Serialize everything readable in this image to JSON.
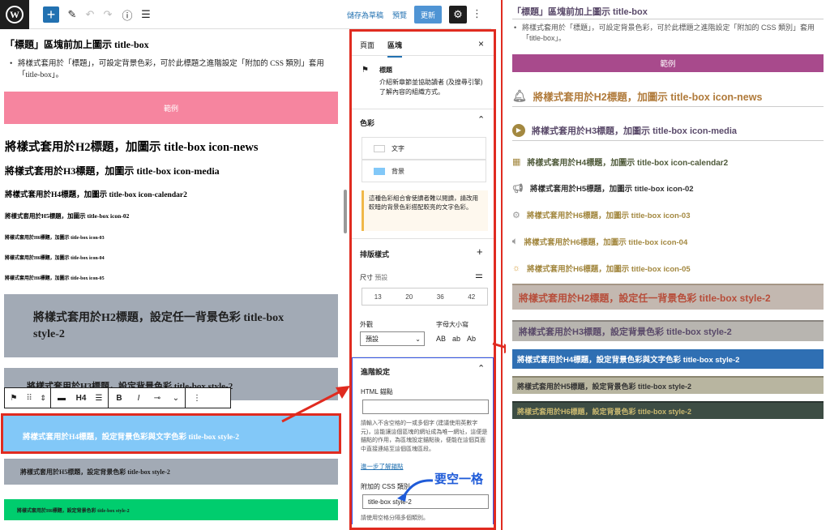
{
  "topbar": {
    "save_draft": "儲存為草稿",
    "preview": "預覽",
    "publish": "更新",
    "block_type": "H4"
  },
  "canvas": {
    "intro_heading": "「標題」區塊前加上圖示 title-box",
    "intro_bullet": "將樣式套用於「標題」，可設定背景色彩，可於此標題之進階設定「附加的 CSS 類別」套用「title-box」。",
    "example": "範例",
    "h2": "將樣式套用於H2標題，加圖示 title-box icon-news",
    "h3": "將樣式套用於H3標題，加圖示 title-box icon-media",
    "h4": "將樣式套用於H4標題，加圖示 title-box icon-calendar2",
    "h5": "將樣式套用於H5標題，加圖示 title-box icon-02",
    "h6a": "將樣式套用於H6標題，加圖示 title-box icon-03",
    "h6b": "將樣式套用於H6標題，加圖示 title-box icon-04",
    "h6c": "將樣式套用於H6標題，加圖示 title-box icon-05",
    "box_h2": "將樣式套用於H2標題，設定任一背景色彩 title-box style-2",
    "box_h3": "將樣式套用於H3標題，設定背景色彩 title-box style-2",
    "box_h4": "將樣式套用於H4標題，設定背景色彩與文字色彩 title-box style-2",
    "box_h5": "將樣式套用於H5標題，設定背景色彩 title-box style-2",
    "box_h6": "將樣式套用於H6標題，設定背景色彩 title-box style-2"
  },
  "sidebar": {
    "tab_page": "頁面",
    "tab_block": "區塊",
    "block_name": "標題",
    "block_desc": "介紹新章節並協助讀者 (及搜尋引擎) 了解內容的組織方式。",
    "color_title": "色彩",
    "color_text": "文字",
    "color_bg": "背景",
    "contrast_notice": "這種色彩組合會使讀者難以閱讀，請改用較暗的背景色彩搭配較亮的文字色彩。",
    "typo_title": "排版樣式",
    "size_label": "尺寸",
    "size_default": "預設",
    "sizes": [
      "13",
      "20",
      "36",
      "42"
    ],
    "appearance_label": "外觀",
    "appearance_value": "預設",
    "case_label": "字母大小寫",
    "case_options": [
      "AB",
      "ab",
      "Ab"
    ],
    "advanced_title": "進階設定",
    "anchor_label": "HTML 錨點",
    "anchor_help": "請輸入不含空格的一或多個字 (建議使用英數字元)，這能讓這個區塊的網址成為唯一網址，這便是錨點的作用，為區塊設定錨點後，便能在這個頁面中直接連結至這個區塊區段。",
    "anchor_link": "進一步了解錨點",
    "css_label": "附加的 CSS 類別",
    "css_value": "title-box style-2",
    "css_help": "請使用空格分隔多個類別。"
  },
  "annotation": {
    "text": "要空一格"
  },
  "right": {
    "heading": "「標題」區塊前加上圖示 title-box",
    "bullet": "將樣式套用於「標題」，可設定背景色彩，可於此標題之進階設定「附加的 CSS 類別」套用「title-box」。",
    "example": "範例",
    "h2": "將樣式套用於H2標題，加圖示 title-box icon-news",
    "h3": "將樣式套用於H3標題，加圖示 title-box icon-media",
    "h4": "將樣式套用於H4標題，加圖示 title-box icon-calendar2",
    "h5": "將樣式套用於H5標題，加圖示 title-box icon-02",
    "h6a": "將樣式套用於H6標題，加圖示 title-box icon-03",
    "h6b": "將樣式套用於H6標題，加圖示 title-box icon-04",
    "h6c": "將樣式套用於H6標題，加圖示 title-box icon-05",
    "s2": "將樣式套用於H2標題，設定任一背景色彩 title-box style-2",
    "s3": "將樣式套用於H3標題，設定背景色彩 title-box style-2",
    "s4": "將樣式套用於H4標題，設定背景色彩與文字色彩 title-box style-2",
    "s5": "將樣式套用於H5標題，設定背景色彩 title-box style-2",
    "s6": "將樣式套用於H6標題，設定背景色彩 title-box style-2"
  },
  "colors": {
    "accent": "#2271b1",
    "pink": "#f6859f",
    "gray": "#a2aab5",
    "lightblue": "#82c8f8",
    "green": "#00cd6e",
    "purple": "#a84a8c",
    "olive": "#a38840",
    "red": "#e02b20"
  }
}
